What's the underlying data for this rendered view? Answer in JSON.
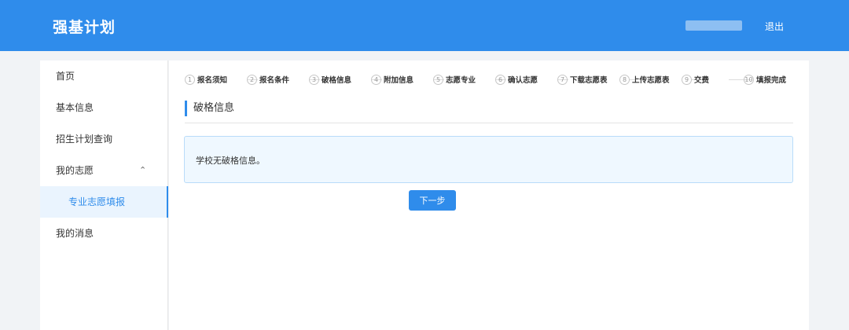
{
  "header": {
    "title": "强基计划",
    "logout_label": "退出"
  },
  "sidebar": {
    "items": [
      {
        "label": "首页"
      },
      {
        "label": "基本信息"
      },
      {
        "label": "招生计划查询"
      },
      {
        "label": "我的志愿",
        "expanded_icon": "chevron-up-icon"
      },
      {
        "label": "专业志愿填报",
        "active": true
      },
      {
        "label": "我的消息"
      }
    ]
  },
  "steps": [
    {
      "num": "1",
      "label": "报名须知"
    },
    {
      "num": "2",
      "label": "报名条件"
    },
    {
      "num": "3",
      "label": "破格信息"
    },
    {
      "num": "4",
      "label": "附加信息"
    },
    {
      "num": "5",
      "label": "志愿专业"
    },
    {
      "num": "6",
      "label": "确认志愿"
    },
    {
      "num": "7",
      "label": "下载志愿表"
    },
    {
      "num": "8",
      "label": "上传志愿表"
    },
    {
      "num": "9",
      "label": "交费"
    },
    {
      "num": "10",
      "label": "填报完成"
    }
  ],
  "main": {
    "section_title": "破格信息",
    "info_text": "学校无破格信息。",
    "next_label": "下一步"
  },
  "colors": {
    "primary": "#2f8ceb",
    "info_bg": "#eff8ff",
    "info_border": "#b9dcfa"
  }
}
